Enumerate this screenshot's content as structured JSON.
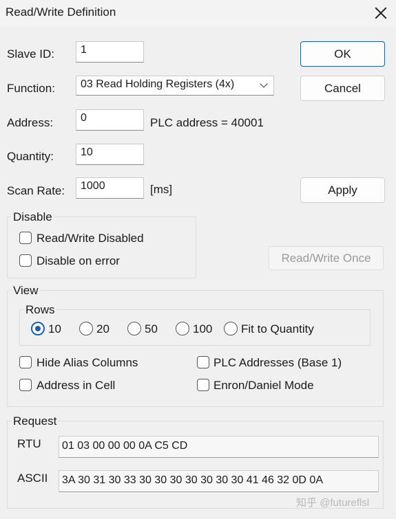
{
  "window": {
    "title": "Read/Write Definition"
  },
  "form": {
    "slave_id_label": "Slave ID:",
    "slave_id_value": "1",
    "function_label": "Function:",
    "function_value": "03 Read Holding Registers (4x)",
    "address_label": "Address:",
    "address_value": "0",
    "plc_address_text": "PLC address = 40001",
    "quantity_label": "Quantity:",
    "quantity_value": "10",
    "scan_rate_label": "Scan Rate:",
    "scan_rate_value": "1000",
    "scan_rate_unit": "[ms]"
  },
  "buttons": {
    "ok": "OK",
    "cancel": "Cancel",
    "apply": "Apply",
    "read_write_once": "Read/Write Once"
  },
  "disable_group": {
    "title": "Disable",
    "read_write_disabled": "Read/Write Disabled",
    "disable_on_error": "Disable on error"
  },
  "view_group": {
    "title": "View",
    "rows_title": "Rows",
    "rows_options": [
      "10",
      "20",
      "50",
      "100",
      "Fit to Quantity"
    ],
    "rows_selected": "10",
    "hide_alias_columns": "Hide Alias Columns",
    "plc_addresses_base1": "PLC Addresses (Base 1)",
    "address_in_cell": "Address in Cell",
    "enron_daniel_mode": "Enron/Daniel Mode"
  },
  "request_group": {
    "title": "Request",
    "rtu_label": "RTU",
    "rtu_value": "01 03 00 00 00 0A C5 CD",
    "ascii_label": "ASCII",
    "ascii_value": "3A 30 31 30 33 30 30 30 30 30 30 30 41 46 32 0D 0A"
  },
  "watermark": "知乎 @futureflsl",
  "colors": {
    "accent": "#1a5fb4",
    "window_bg": "#f0f0f0"
  }
}
